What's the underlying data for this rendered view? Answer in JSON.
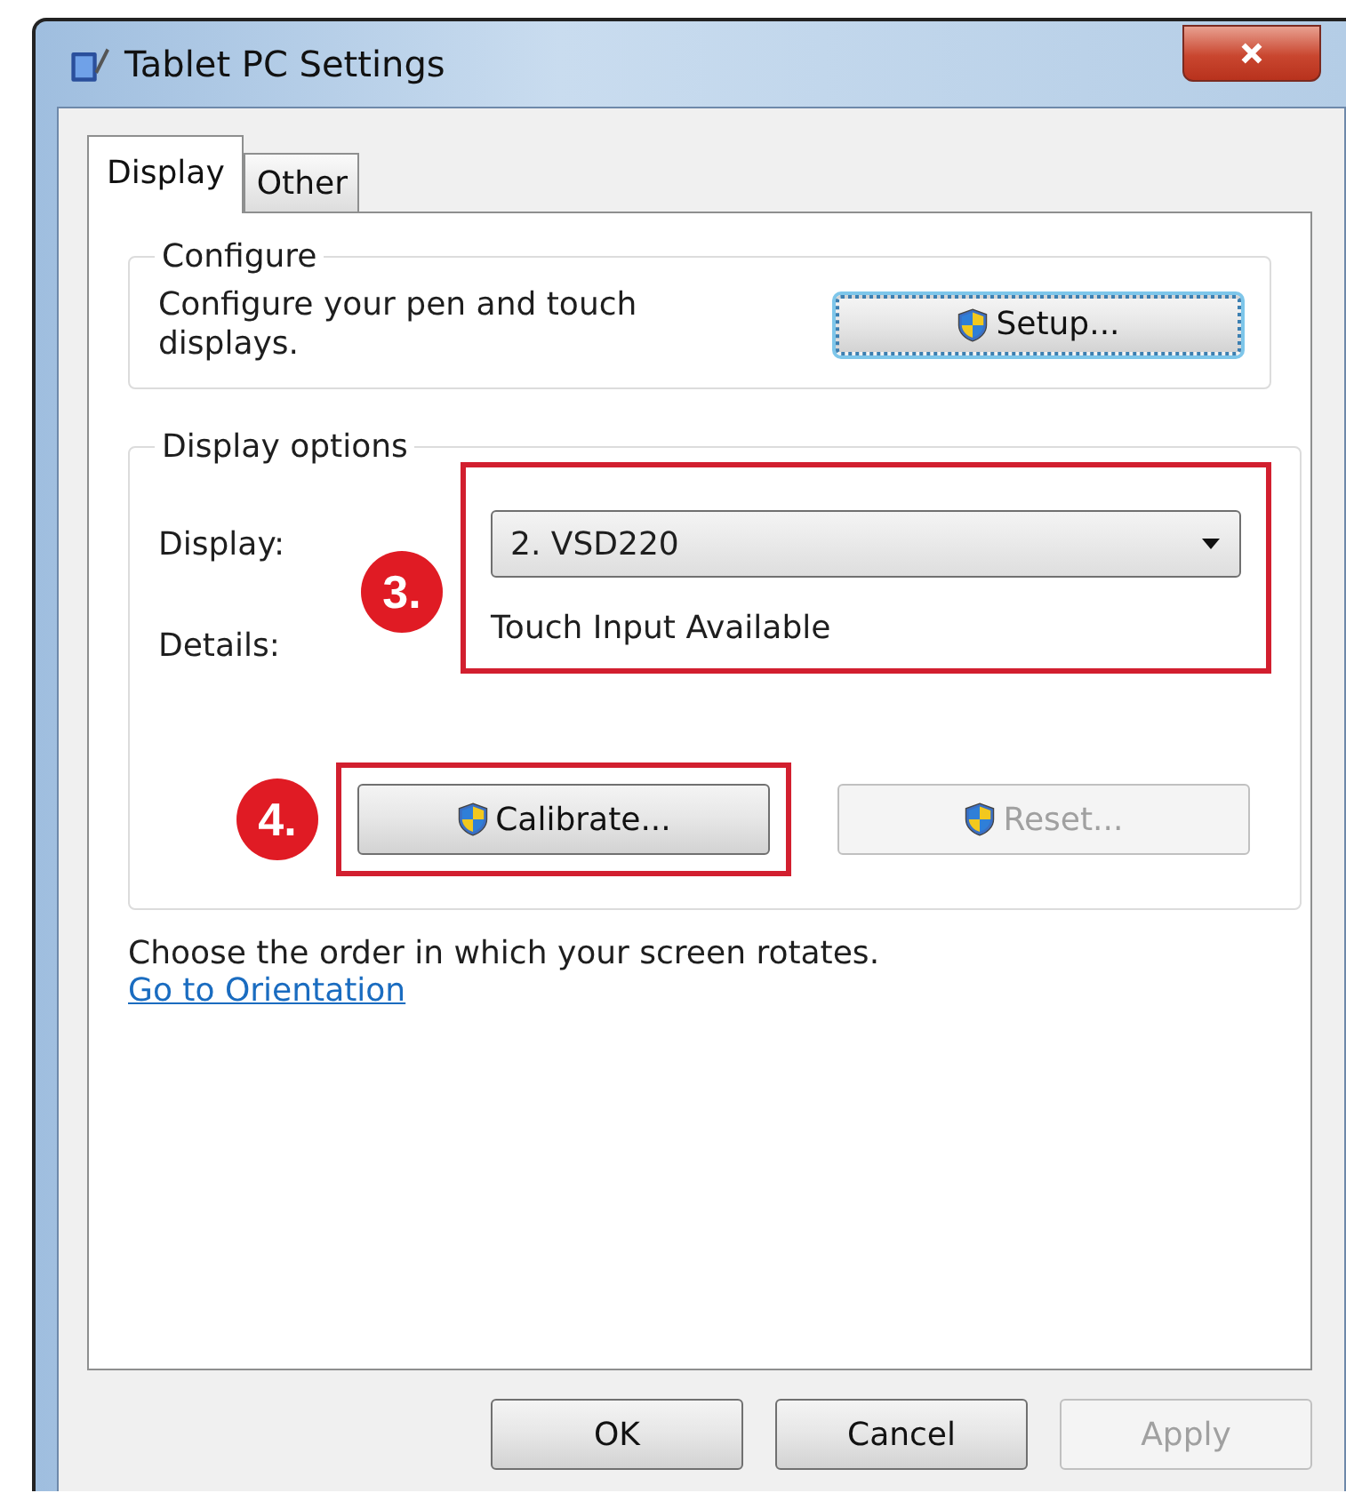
{
  "window": {
    "title": "Tablet PC Settings"
  },
  "tabs": [
    {
      "label": "Display",
      "selected": true
    },
    {
      "label": "Other",
      "selected": false
    }
  ],
  "configure": {
    "title": "Configure",
    "text": "Configure your pen and touch displays.",
    "button": {
      "label": "Setup...",
      "disabled": false,
      "focused": true
    }
  },
  "display_options": {
    "title": "Display options",
    "display_label": "Display:",
    "display_value": "2. VSD220",
    "details_label": "Details:",
    "details_value": "Touch Input Available",
    "callout": "3.",
    "buttons": [
      {
        "label": "Calibrate...",
        "disabled": false,
        "focused": false,
        "callout": "4."
      },
      {
        "label": "Reset...",
        "disabled": true,
        "focused": false
      }
    ]
  },
  "orientation": {
    "text": "Choose the order in which your screen rotates.",
    "link": "Go to Orientation"
  },
  "buttons": [
    {
      "label": "OK",
      "disabled": false
    },
    {
      "label": "Cancel",
      "disabled": false
    },
    {
      "label": "Apply",
      "disabled": true
    }
  ]
}
